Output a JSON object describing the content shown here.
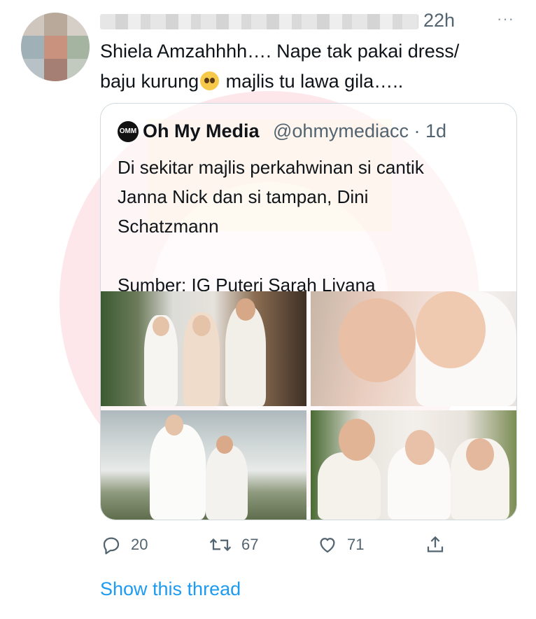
{
  "tweet": {
    "time": "22h",
    "more_label": "···",
    "text": "Shiela Amzahhhh…. Nape tak pakai dress/\nbaju kurung",
    "text_after_emoji": " majlis tu lawa gila…..",
    "emoji": "pleading-face-emoji"
  },
  "quote": {
    "logo_text": "OMM",
    "name": "Oh My Media",
    "handle_time": "@ohmymediacc · 1d",
    "text": "Di sekitar majlis perkahwinan si cantik\nJanna Nick  dan si tampan, Dini\nSchatzmann\n\nSumber: IG Puteri Sarah Liyana"
  },
  "actions": {
    "reply_count": "20",
    "retweet_count": "67",
    "like_count": "71"
  },
  "show_thread_label": "Show this thread",
  "colors": {
    "text": "#0f1419",
    "secondary": "#536471",
    "link": "#1d9bf0",
    "border": "#cfd9de",
    "watermark": "#f7c6cc"
  },
  "icons": [
    "reply-icon",
    "retweet-icon",
    "like-icon",
    "share-icon"
  ]
}
